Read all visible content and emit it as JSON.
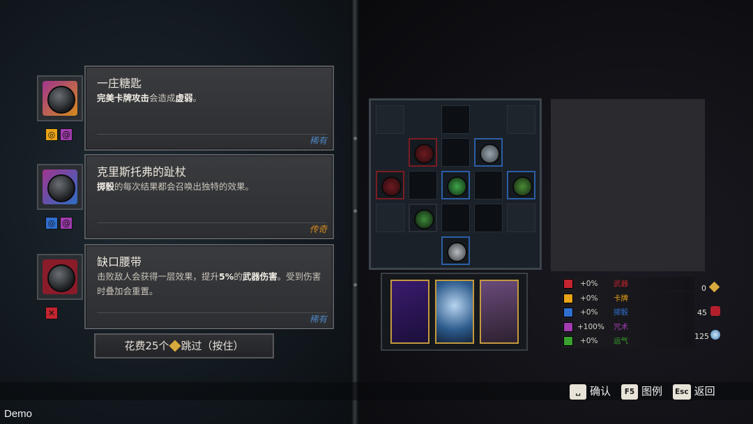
{
  "relics": [
    {
      "title": "一庄糖匙",
      "desc_parts": [
        {
          "t": "完美卡牌攻击",
          "b": true
        },
        {
          "t": "会造成",
          "b": false
        },
        {
          "t": "虚弱",
          "b": true
        },
        {
          "t": "。",
          "b": false
        }
      ],
      "rarity": "稀有",
      "rarity_color": "#4e86c4",
      "icon": "spoon-icon",
      "frame_colors": [
        "#a0348e",
        "#d48a1c"
      ],
      "tags": [
        {
          "icon": "sun-tag-icon",
          "glyph": "◎",
          "color": "#e8a317"
        },
        {
          "icon": "spiral-tag-icon",
          "glyph": "@",
          "color": "#a23cb0"
        }
      ]
    },
    {
      "title": "克里斯托弗的趾杖",
      "desc_parts": [
        {
          "t": "掷骰",
          "b": true
        },
        {
          "t": "的每次结果都会召唤出独特的效果。",
          "b": false
        }
      ],
      "rarity": "传奇",
      "rarity_color": "#d48a1c",
      "icon": "claw-staff-icon",
      "frame_colors": [
        "#a0348e",
        "#2d6cc4"
      ],
      "tags": [
        {
          "icon": "dice-tag-icon",
          "glyph": "◎",
          "color": "#2f6fd0"
        },
        {
          "icon": "spiral-tag-icon",
          "glyph": "@",
          "color": "#a23cb0"
        }
      ]
    },
    {
      "title": "缺口腰带",
      "desc_parts": [
        {
          "t": "击败敌人会获得一层效果，提升",
          "b": false
        },
        {
          "t": "5%",
          "b": true
        },
        {
          "t": "的",
          "b": false
        },
        {
          "t": "武器伤害",
          "b": true
        },
        {
          "t": "。受到伤害时叠加会重置。",
          "b": false
        }
      ],
      "rarity": "稀有",
      "rarity_color": "#4e86c4",
      "icon": "belt-icon",
      "frame_colors": [
        "#8a1c2a",
        "#8a1c2a"
      ],
      "tags": [
        {
          "icon": "sword-tag-icon",
          "glyph": "✕",
          "color": "#c3242f"
        }
      ]
    }
  ],
  "skip_button": {
    "prefix": "花费25个",
    "suffix": "跳过（按住）"
  },
  "stats": [
    {
      "value": "+0%",
      "name": "武器",
      "color": "#c3242f"
    },
    {
      "value": "+0%",
      "name": "卡牌",
      "color": "#e8a317"
    },
    {
      "value": "+0%",
      "name": "掷骰",
      "color": "#2f6fd0"
    },
    {
      "value": "+100%",
      "name": "咒术",
      "color": "#a23cb0"
    },
    {
      "value": "+0%",
      "name": "运气",
      "color": "#3aa12e"
    }
  ],
  "resources": {
    "gems": "0",
    "health": "45",
    "orbs": "125"
  },
  "footer": {
    "confirm_key": "␣",
    "confirm_label": "确认",
    "legend_key": "F5",
    "legend_label": "图例",
    "back_key": "Esc",
    "back_label": "返回"
  },
  "watermark": "Demo"
}
